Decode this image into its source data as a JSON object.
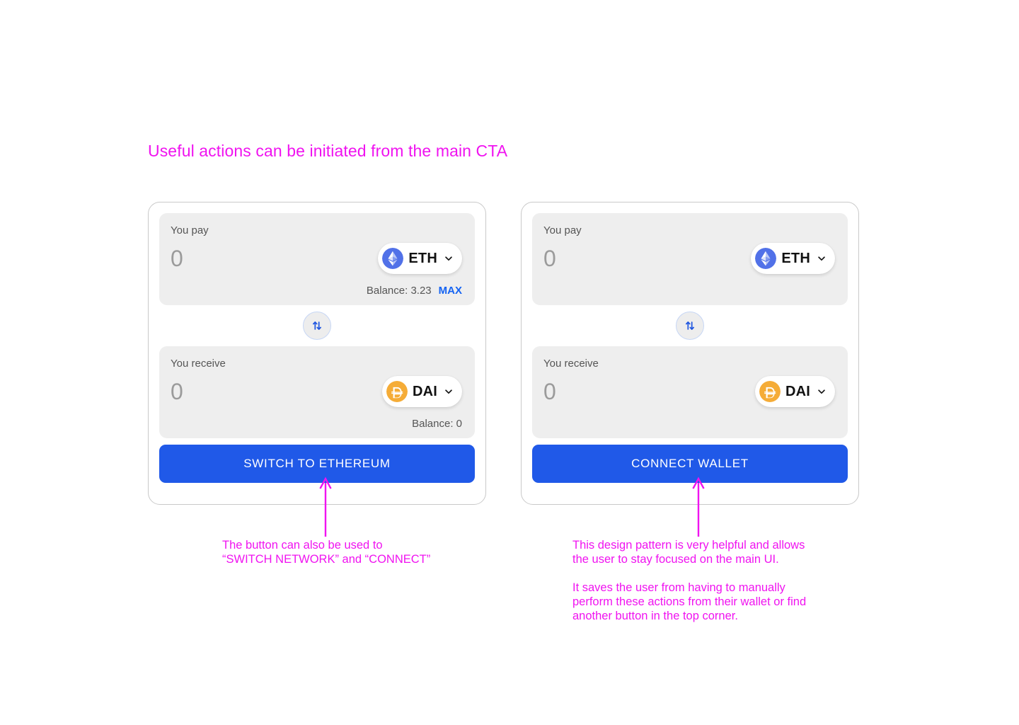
{
  "page": {
    "title": "Useful actions can be initiated from the main CTA",
    "accent_magenta": "#f013f0",
    "accent_blue": "#2059e8",
    "panel_bg": "#eeeeee",
    "card_border": "#c9c9c9"
  },
  "cards": [
    {
      "id": "switch-network-card",
      "pay": {
        "label": "You pay",
        "value": "0",
        "placeholder": "0",
        "token": {
          "symbol": "ETH",
          "icon": "ethereum-icon",
          "color": "#5171e8"
        },
        "balance_label": "Balance: 3.23",
        "max_label": "MAX",
        "has_balance": true
      },
      "swap_icon": "swap-vertical-icon",
      "receive": {
        "label": "You receive",
        "value": "0",
        "placeholder": "0",
        "token": {
          "symbol": "DAI",
          "icon": "dai-icon",
          "color": "#f5ac37"
        },
        "balance_label": "Balance: 0",
        "has_balance": true
      },
      "cta_label": "SWITCH TO ETHEREUM"
    },
    {
      "id": "connect-wallet-card",
      "pay": {
        "label": "You pay",
        "value": "0",
        "placeholder": "0",
        "token": {
          "symbol": "ETH",
          "icon": "ethereum-icon",
          "color": "#5171e8"
        },
        "balance_label": "",
        "max_label": "",
        "has_balance": false
      },
      "swap_icon": "swap-vertical-icon",
      "receive": {
        "label": "You receive",
        "value": "0",
        "placeholder": "0",
        "token": {
          "symbol": "DAI",
          "icon": "dai-icon",
          "color": "#f5ac37"
        },
        "balance_label": "",
        "has_balance": false
      },
      "cta_label": "CONNECT WALLET"
    }
  ],
  "annotations": {
    "left": "The button can also be used to\n“SWITCH NETWORK” and “CONNECT”",
    "right_1": "This design pattern is very helpful and allows\nthe user to stay focused on the main UI.",
    "right_2": "It saves the user from having to manually\nperform these actions from their wallet or find\nanother button in the top corner."
  }
}
